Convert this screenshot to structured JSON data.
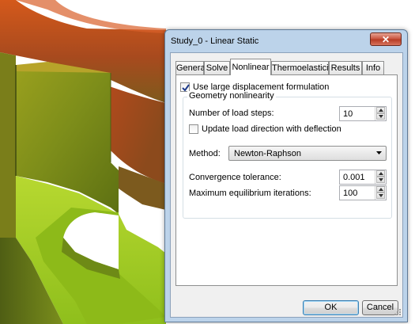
{
  "dialog": {
    "title": "Study_0 - Linear Static",
    "close_label": "✕",
    "tabs": [
      {
        "label": "General"
      },
      {
        "label": "Solve"
      },
      {
        "label": "Nonlinear"
      },
      {
        "label": "Thermoelasticity"
      },
      {
        "label": "Results"
      },
      {
        "label": "Info"
      }
    ],
    "active_tab": "Nonlinear"
  },
  "nonlinear": {
    "large_displacement_label": "Use large displacement formulation",
    "large_displacement_checked": true,
    "geometry_group_title": "Geometry nonlinearity",
    "load_steps_label": "Number of load steps:",
    "load_steps_value": "10",
    "update_load_label": "Update load direction with deflection",
    "update_load_checked": false,
    "method_label": "Method:",
    "method_value": "Newton-Raphson",
    "tolerance_label": "Convergence tolerance:",
    "tolerance_value": "0.001",
    "iterations_label": "Maximum equilibrium iterations:",
    "iterations_value": "100"
  },
  "buttons": {
    "ok_label": "OK",
    "cancel_label": "Cancel"
  },
  "colors": {
    "model_orange": "#c2501c",
    "model_green": "#9ec82a",
    "dialog_frame": "#bcd3ea"
  },
  "icons": [
    "close-icon",
    "checkmark-icon",
    "spin-up-icon",
    "spin-down-icon",
    "dropdown-arrow-icon",
    "resize-grip-icon"
  ]
}
